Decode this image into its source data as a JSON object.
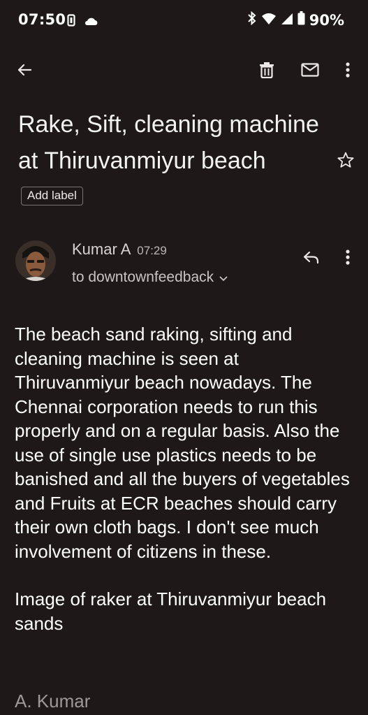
{
  "status_bar": {
    "time": "07:50",
    "battery": "90%",
    "icons": [
      "vibrate-icon",
      "cloud-icon",
      "bluetooth-icon",
      "wifi-icon",
      "signal-icon",
      "battery-icon"
    ]
  },
  "toolbar": {
    "icons": [
      "back-arrow-icon",
      "delete-icon",
      "mark-unread-icon",
      "more-vert-icon"
    ]
  },
  "email": {
    "subject": "Rake, Sift, cleaning machine at  Thiruvanmiyur beach",
    "add_label": "Add label",
    "sender": {
      "name": "Kumar A",
      "time": "07:29",
      "recipient": "to downtownfeedback"
    },
    "body_paragraphs": [
      "The beach sand raking, sifting and cleaning machine is seen at Thiruvanmiyur beach nowadays. The Chennai corporation needs to run this properly and on a regular basis. Also the use of single use plastics needs to be banished and all the buyers of vegetables and Fruits at ECR beaches should carry their own cloth bags. I don't see much involvement of citizens in these.",
      "Image of raker at Thiruvanmiyur beach sands"
    ],
    "signature": "A. Kumar"
  }
}
